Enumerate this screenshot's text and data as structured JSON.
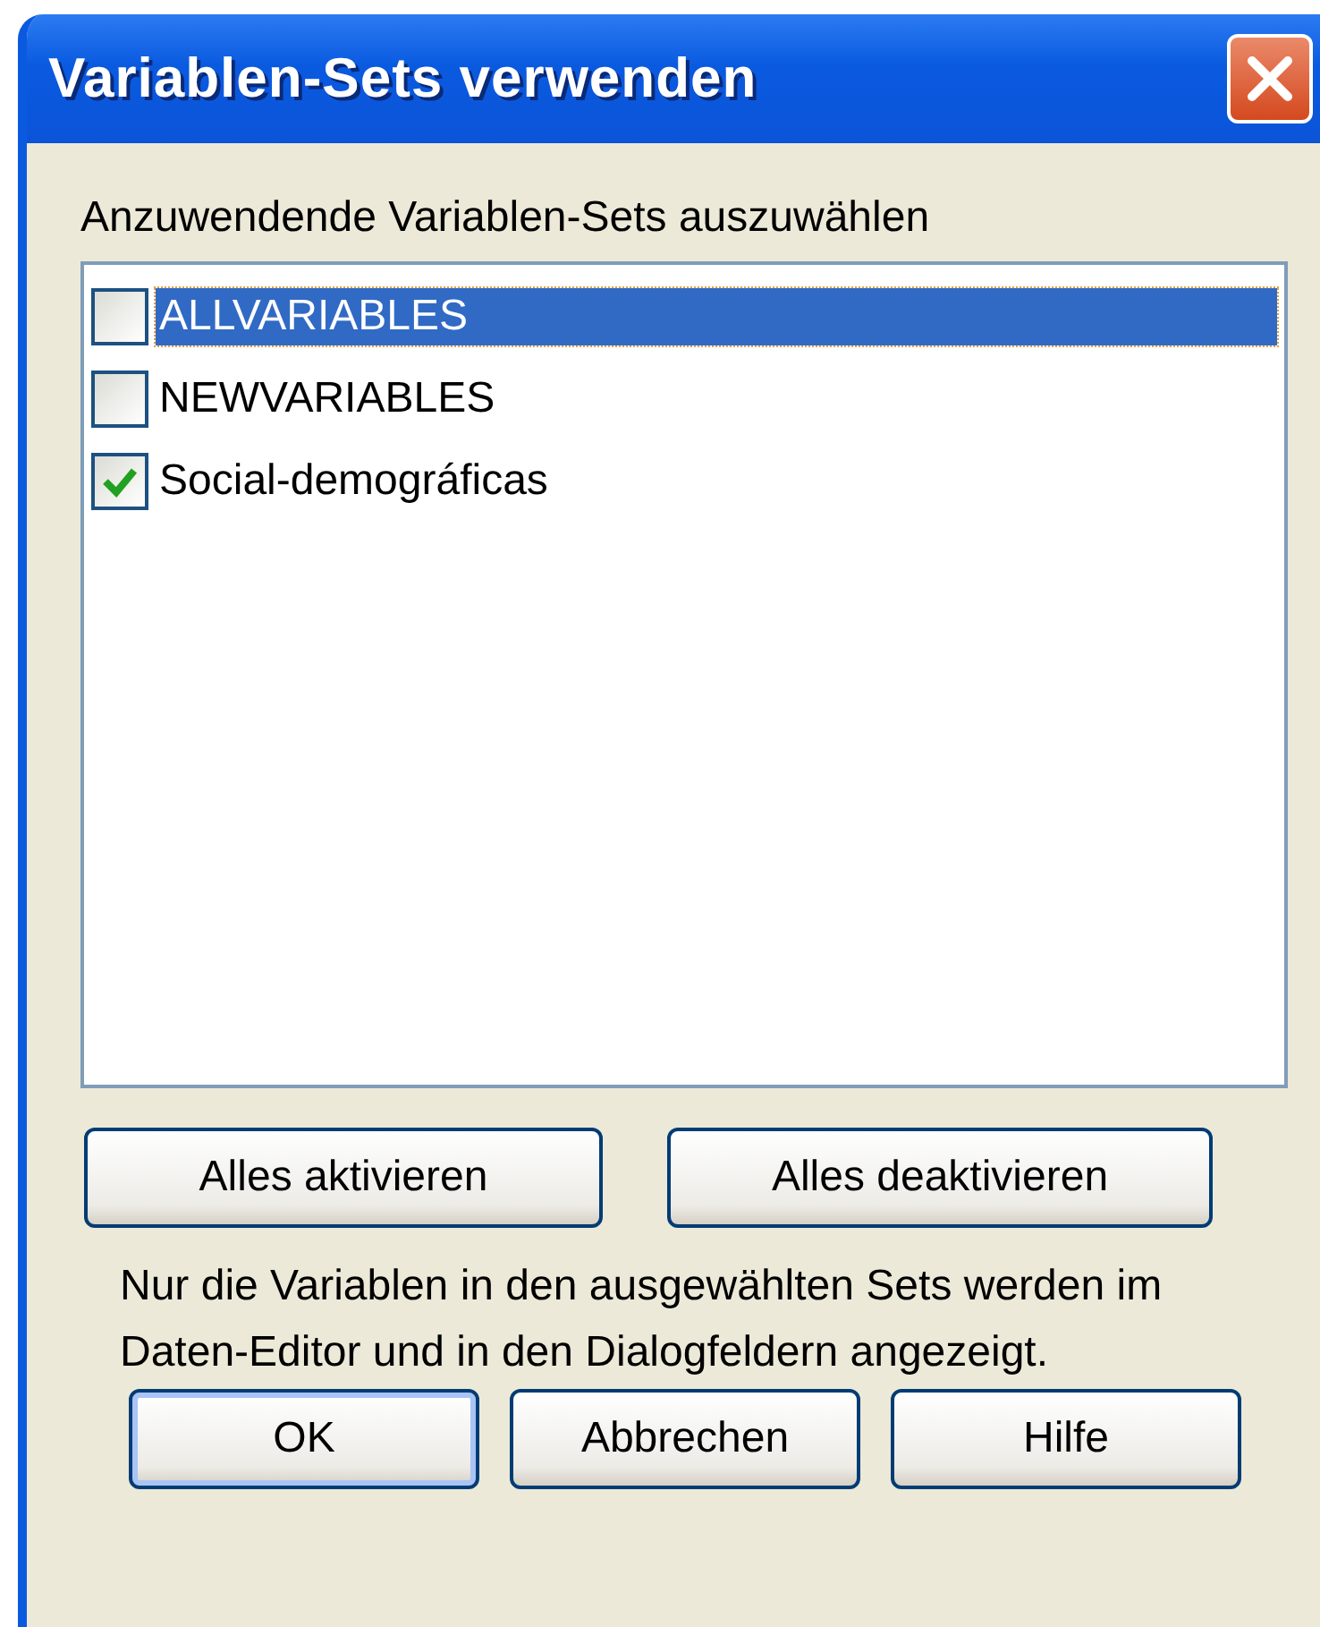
{
  "window": {
    "title": "Variablen-Sets verwenden"
  },
  "list_label": "Anzuwendende Variablen-Sets auszuwählen",
  "sets": [
    {
      "label": "ALLVARIABLES",
      "checked": false,
      "selected": true
    },
    {
      "label": "NEWVARIABLES",
      "checked": false,
      "selected": false
    },
    {
      "label": "Social-demográficas",
      "checked": true,
      "selected": false
    }
  ],
  "list_buttons": [
    "Alles aktivieren",
    "Alles deaktivieren"
  ],
  "note": "Nur die Variablen in den ausgewählten Sets werden im Daten-Editor und in den Dialogfeldern angezeigt.",
  "dialog_buttons": [
    {
      "label": "OK",
      "default": true
    },
    {
      "label": "Abbrechen",
      "default": false
    },
    {
      "label": "Hilfe",
      "default": false
    }
  ]
}
